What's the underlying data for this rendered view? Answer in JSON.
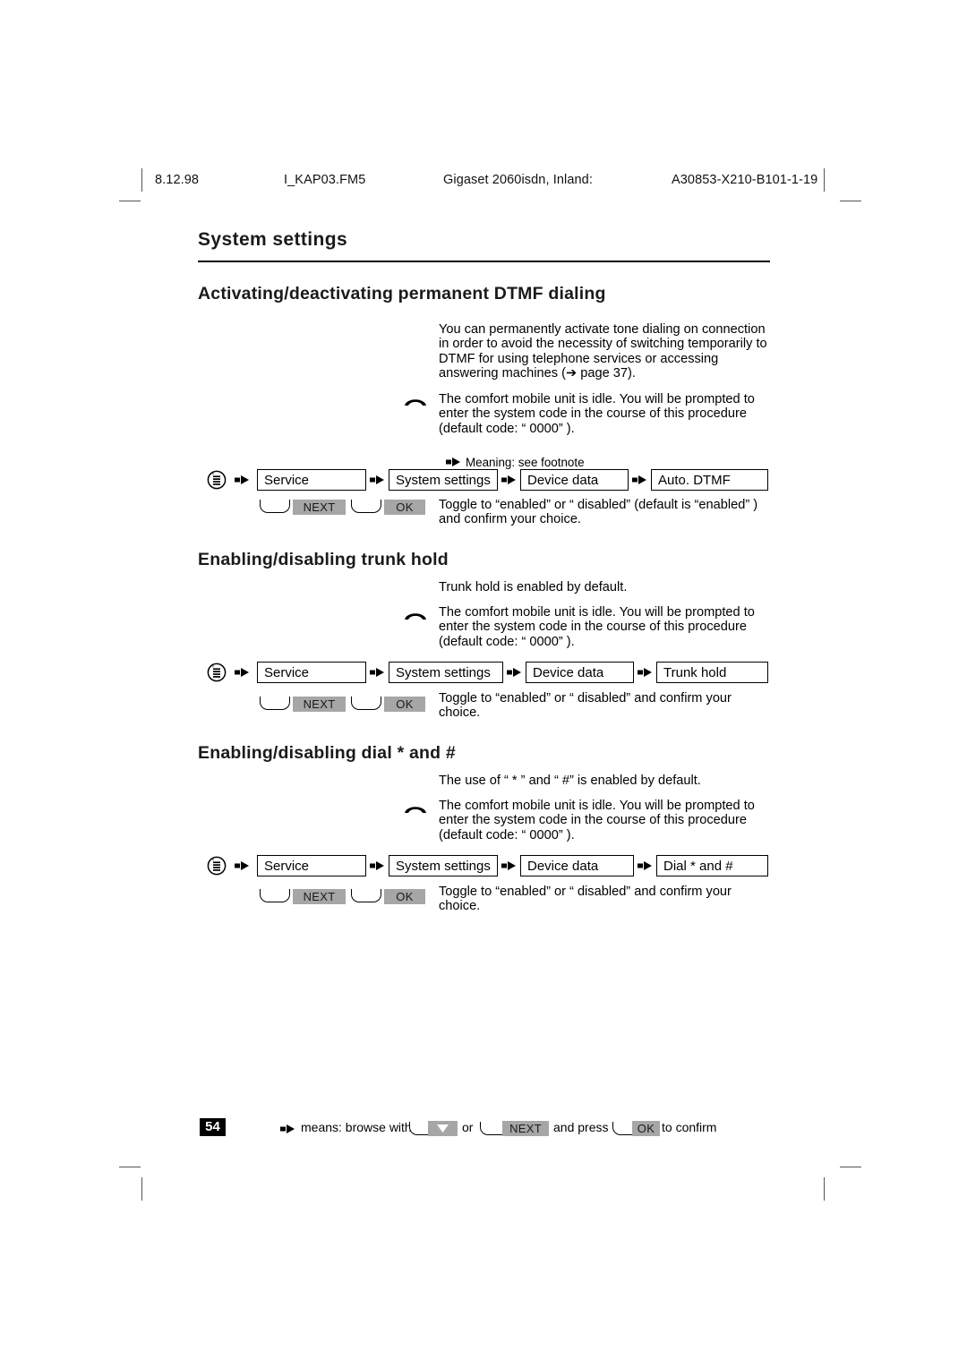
{
  "header": {
    "date": "8.12.98",
    "file": "I_KAP03.FM5",
    "product": "Gigaset 2060isdn, Inland:",
    "doc_code": "A30853-X210-B101-1-19"
  },
  "chapter_title": "System settings",
  "sections": [
    {
      "heading": "Activating/deactivating permanent DTMF dialing",
      "intro": "You can permanently activate tone dialing on connection in order to avoid the necessity of switching temporarily to DTMF for using telephone services or accessing answering machines (➔ page 37).",
      "handset_note": "The comfort mobile unit is idle. You will be prompted to enter the system code in the course of this procedure (default code: “ 0000” ).",
      "meaning_note": "Meaning: see footnote",
      "flow": [
        "Service",
        "System settings",
        "Device data",
        "Auto. DTMF"
      ],
      "keys": [
        {
          "label": "NEXT"
        },
        {
          "label": "OK"
        }
      ],
      "action": "Toggle to “enabled”  or “ disabled”  (default is “enabled” ) and confirm your choice."
    },
    {
      "heading": "Enabling/disabling trunk hold",
      "intro": "Trunk hold is enabled by default.",
      "handset_note": "The comfort mobile unit is idle. You will be prompted to enter the system code in the course of this procedure (default code: “ 0000” ).",
      "flow": [
        "Service",
        "System settings",
        "Device data",
        "Trunk hold"
      ],
      "keys": [
        {
          "label": "NEXT"
        },
        {
          "label": "OK"
        }
      ],
      "action": "Toggle to “enabled”  or “ disabled”  and confirm your choice."
    },
    {
      "heading": "Enabling/disabling dial * and #",
      "intro": "The use of “ * ” and “ #”  is enabled by default.",
      "handset_note": "The comfort mobile unit is idle. You will be prompted to enter the system code in the course of this procedure (default code: “ 0000” ).",
      "flow": [
        "Service",
        "System settings",
        "Device data",
        "Dial * and #"
      ],
      "keys": [
        {
          "label": "NEXT"
        },
        {
          "label": "OK"
        }
      ],
      "action": "Toggle to “enabled”  or “ disabled”  and confirm your choice."
    }
  ],
  "footer": {
    "page_number": "54",
    "means_label": "means: browse with",
    "or_label": "or",
    "next_label": "NEXT",
    "and_press_label": "and press",
    "ok_label": "OK",
    "to_confirm_label": "to confirm"
  },
  "icons": {
    "menu": "menu-list-circle-icon",
    "handset": "handset-icon",
    "flow_arrow": "flow-arrow-icon",
    "down_arrow": "down-arrow-icon"
  },
  "colors": {
    "chip_grey": "#a6a6a6",
    "ink": "#000000",
    "page_bg": "#ffffff"
  }
}
